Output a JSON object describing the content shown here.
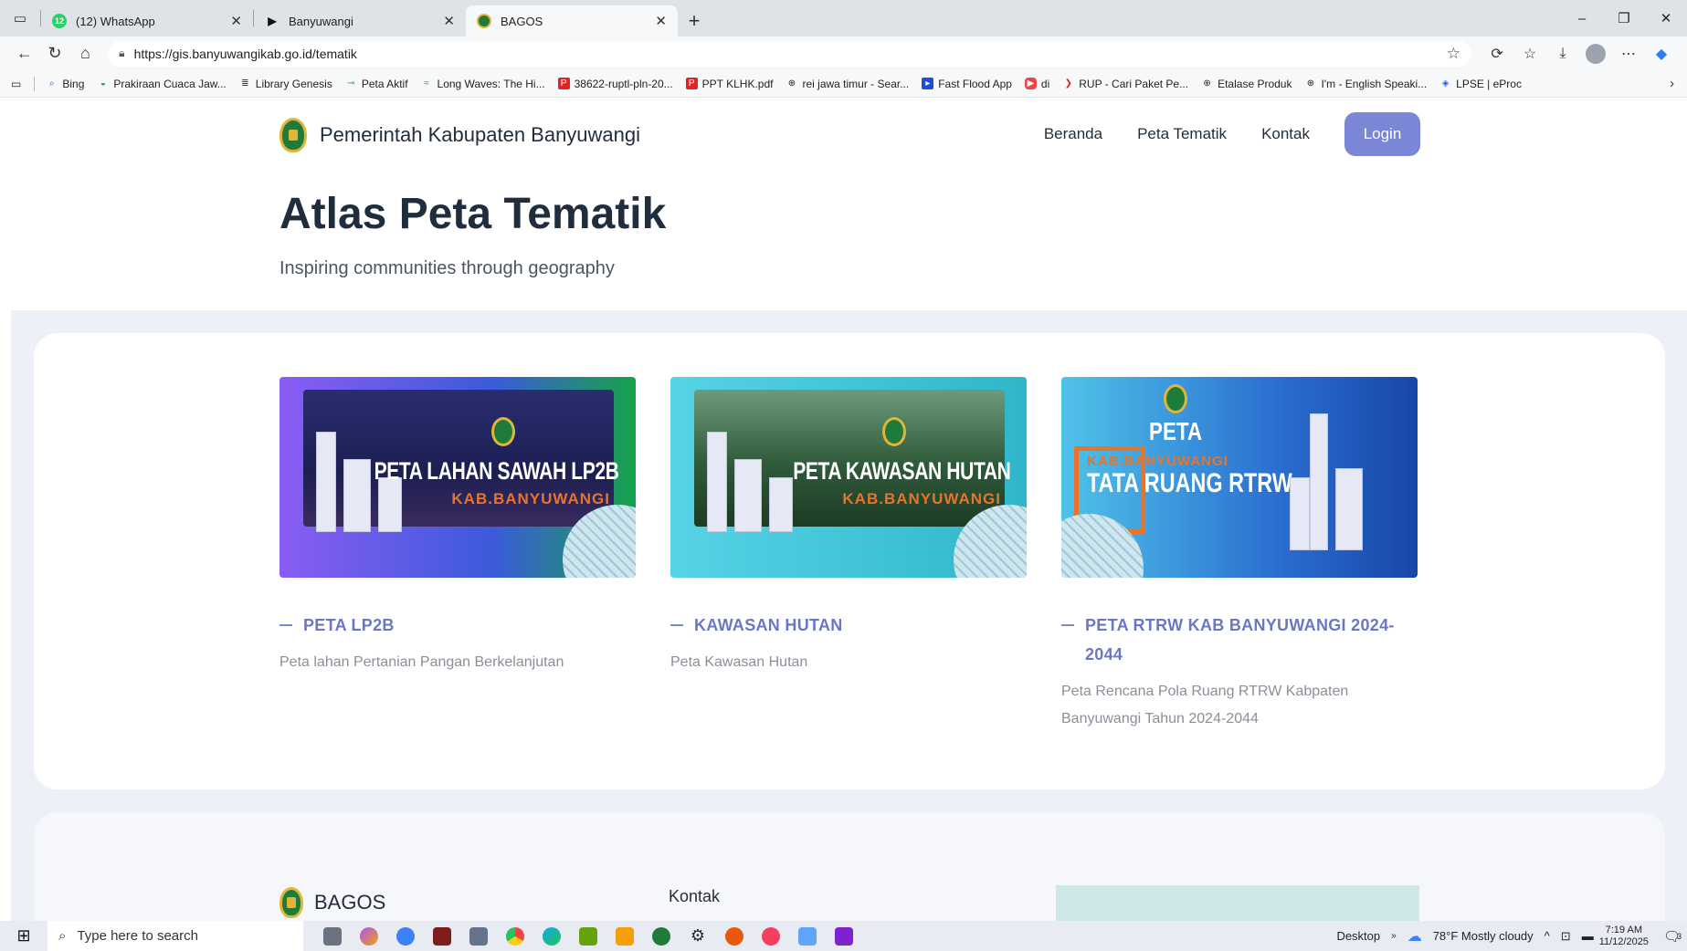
{
  "browser": {
    "tabs": [
      {
        "label": "(12) WhatsApp",
        "favicon": "whatsapp-icon",
        "badge": "12",
        "active": false
      },
      {
        "label": "Banyuwangi",
        "favicon": "play-icon",
        "active": false
      },
      {
        "label": "BAGOS",
        "favicon": "emblem-icon",
        "active": true
      }
    ],
    "url": "https://gis.banyuwangikab.go.id/tematik",
    "bookmarks": [
      "Bing",
      "Prakiraan Cuaca Jaw...",
      "Library Genesis",
      "Peta Aktif",
      "Long Waves: The Hi...",
      "38622-ruptl-pln-20...",
      "PPT KLHK.pdf",
      "rei jawa timur - Sear...",
      "Fast Flood App",
      "di",
      "RUP - Cari Paket Pe...",
      "Etalase Produk",
      "I'm - English Speaki...",
      "LPSE | eProc"
    ]
  },
  "site": {
    "brand": "Pemerintah Kabupaten Banyuwangi",
    "nav": [
      "Beranda",
      "Peta Tematik",
      "Kontak"
    ],
    "login": "Login",
    "hero_title": "Atlas Peta Tematik",
    "hero_subtitle": "Inspiring communities through geography",
    "cards": [
      {
        "image_title": "PETA LAHAN SAWAH LP2B",
        "image_sub": "KAB.BANYUWANGI",
        "title": "PETA LP2B",
        "desc": "Peta lahan Pertanian Pangan Berkelanjutan"
      },
      {
        "image_title": "PETA KAWASAN HUTAN",
        "image_sub": "KAB.BANYUWANGI",
        "title": "KAWASAN HUTAN",
        "desc": "Peta Kawasan Hutan"
      },
      {
        "image_title": "TATA RUANG RTRW",
        "image_top": "PETA",
        "image_sub": "KAB.BANYUWANGI",
        "title": "PETA RTRW KAB BANYUWANGI 2024-2044",
        "desc": "Peta Rencana Pola Ruang RTRW Kabpaten Banyuwangi Tahun 2024-2044"
      }
    ],
    "footer_brand": "BAGOS",
    "footer_kontak": "Kontak"
  },
  "taskbar": {
    "search_placeholder": "Type here to search",
    "desktop_label": "Desktop",
    "weather": "78°F  Mostly cloudy",
    "time": "7:19 AM",
    "date": "11/12/2025",
    "notification_count": "3"
  },
  "colors": {
    "accent": "#7c86d6",
    "page_bg": "#eef0f8",
    "card_title": "#6b77c4"
  }
}
